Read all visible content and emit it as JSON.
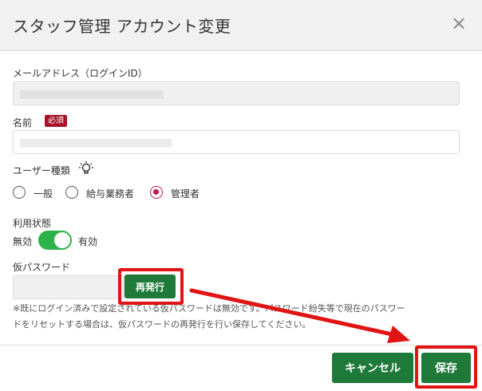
{
  "modal": {
    "title": "スタッフ管理 アカウント変更",
    "close_symbol": "×"
  },
  "form": {
    "email": {
      "label": "メールアドレス（ログインID）"
    },
    "name": {
      "label": "名前",
      "required_badge": "必須"
    },
    "user_type": {
      "label": "ユーザー種類",
      "options": [
        {
          "label": "一般",
          "checked": false
        },
        {
          "label": "給与業務者",
          "checked": false
        },
        {
          "label": "管理者",
          "checked": true
        }
      ]
    },
    "status": {
      "label": "利用状態",
      "off_label": "無効",
      "on_label": "有効",
      "enabled": true
    },
    "temp_password": {
      "label": "仮パスワード",
      "reissue_button": "再発行",
      "note_line1": "※既にログイン済みで設定されている仮パスワードは無効です。パスワード紛失等で現在のパスワー",
      "note_line2": "ドをリセットする場合は、仮パスワードの再発行を行い保存してください。"
    }
  },
  "footer": {
    "cancel_label": "キャンセル",
    "save_label": "保存"
  },
  "colors": {
    "primary_green": "#1f7a3a",
    "toggle_green": "#2db34a",
    "required_red": "#a3132a",
    "radio_accent": "#c8164b",
    "highlight_red": "#e11414"
  }
}
